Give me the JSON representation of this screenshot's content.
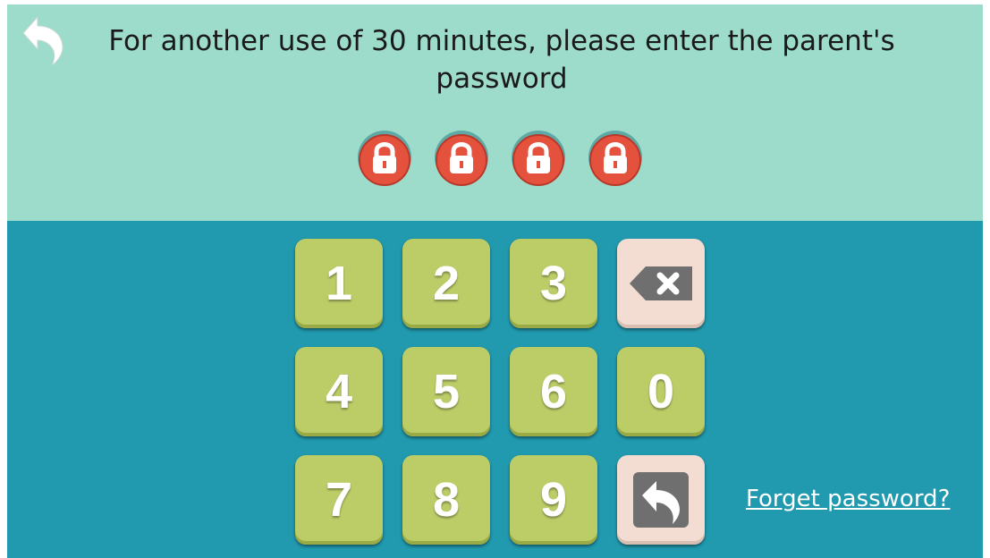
{
  "header": {
    "back_icon": "back-arrow-icon",
    "prompt": "For another use of 30 minutes, please enter the parent's password"
  },
  "pin_slots": [
    {
      "icon": "lock-icon",
      "state": "empty"
    },
    {
      "icon": "lock-icon",
      "state": "empty"
    },
    {
      "icon": "lock-icon",
      "state": "empty"
    },
    {
      "icon": "lock-icon",
      "state": "empty"
    }
  ],
  "keypad": {
    "keys": [
      "1",
      "2",
      "3",
      "4",
      "5",
      "6",
      "0",
      "7",
      "8",
      "9"
    ],
    "delete_icon": "backspace-icon",
    "return_icon": "return-arrow-icon"
  },
  "links": {
    "forget_password": "Forget password?"
  },
  "colors": {
    "top_background": "#9ddccb",
    "bottom_background": "#2199ae",
    "key_green": "#bccd68",
    "key_light": "#f3ddd2",
    "lock_red": "#e4513c"
  }
}
